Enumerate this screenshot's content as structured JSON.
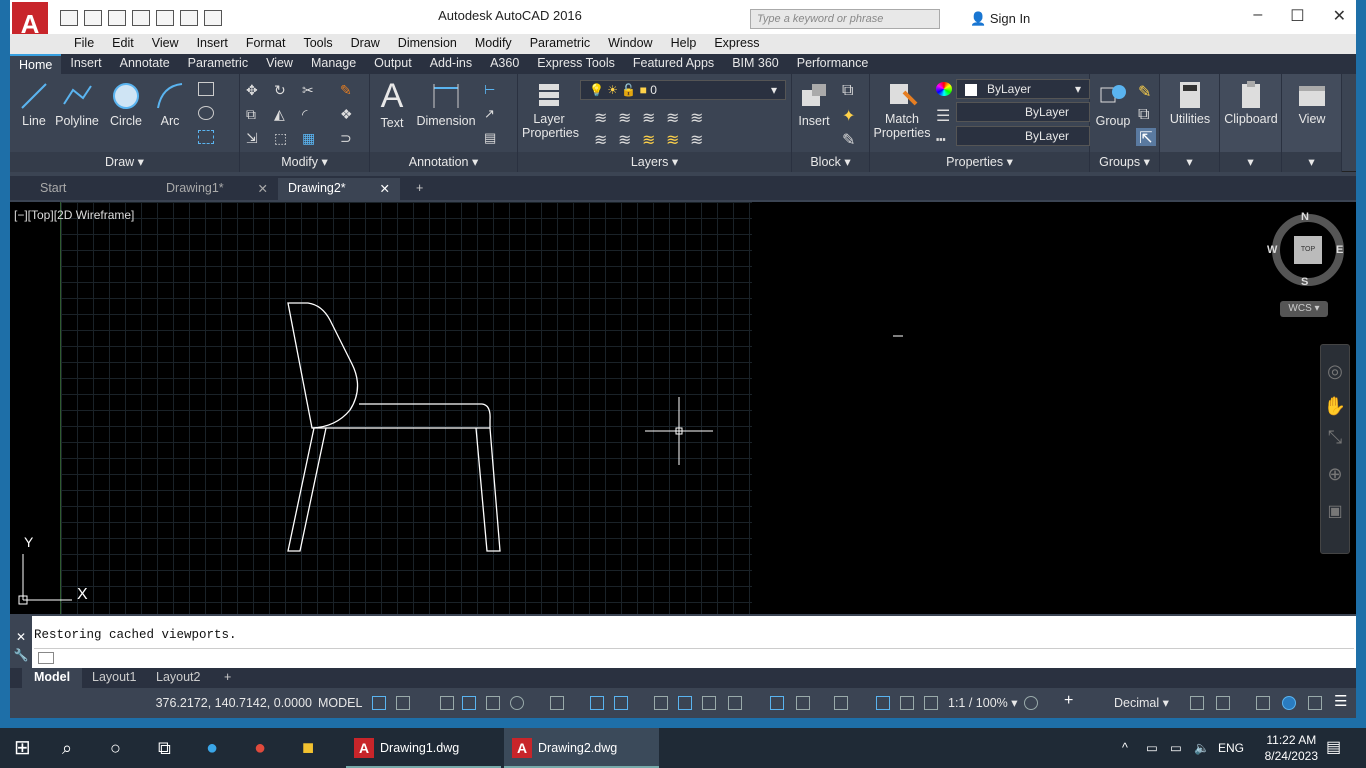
{
  "window": {
    "title": "Autodesk AutoCAD 2016",
    "search_placeholder": "Type a keyword or phrase",
    "sign_in": "Sign In"
  },
  "menubar": [
    "File",
    "Edit",
    "View",
    "Insert",
    "Format",
    "Tools",
    "Draw",
    "Dimension",
    "Modify",
    "Parametric",
    "Window",
    "Help",
    "Express"
  ],
  "ribbon_tabs": [
    "Home",
    "Insert",
    "Annotate",
    "Parametric",
    "View",
    "Manage",
    "Output",
    "Add-ins",
    "A360",
    "Express Tools",
    "Featured Apps",
    "BIM 360",
    "Performance"
  ],
  "ribbon": {
    "draw": {
      "title": "Draw",
      "line": "Line",
      "polyline": "Polyline",
      "circle": "Circle",
      "arc": "Arc"
    },
    "modify": {
      "title": "Modify"
    },
    "annotation": {
      "title": "Annotation",
      "text": "Text",
      "dimension": "Dimension"
    },
    "layers": {
      "title": "Layers",
      "layer_properties": "Layer Properties",
      "current_layer": "0"
    },
    "block": {
      "title": "Block",
      "insert": "Insert"
    },
    "properties": {
      "title": "Properties",
      "match_properties": "Match Properties",
      "color": "ByLayer",
      "linetype": "ByLayer",
      "lineweight": "ByLayer"
    },
    "groups": {
      "title": "Groups",
      "group": "Group"
    },
    "utilities": "Utilities",
    "clipboard": "Clipboard",
    "view": "View"
  },
  "doc_tabs": [
    {
      "label": "Start"
    },
    {
      "label": "Drawing1*"
    },
    {
      "label": "Drawing2*"
    }
  ],
  "viewport": {
    "label": "[−][Top][2D Wireframe]",
    "compass": {
      "n": "N",
      "s": "S",
      "e": "E",
      "w": "W",
      "cube": "TOP"
    },
    "wcs": "WCS",
    "ucs_x": "X",
    "ucs_y": "Y"
  },
  "command": {
    "history": "Restoring cached viewports."
  },
  "layout_tabs": [
    "Model",
    "Layout1",
    "Layout2"
  ],
  "status": {
    "coords": "376.2172, 140.7142, 0.0000",
    "mode": "MODEL",
    "scale": "1:1 / 100%",
    "units": "Decimal"
  },
  "taskbar": {
    "apps": [
      "Drawing1.dwg",
      "Drawing2.dwg"
    ],
    "lang": "ENG",
    "time": "11:22 AM",
    "date": "8/24/2023"
  }
}
